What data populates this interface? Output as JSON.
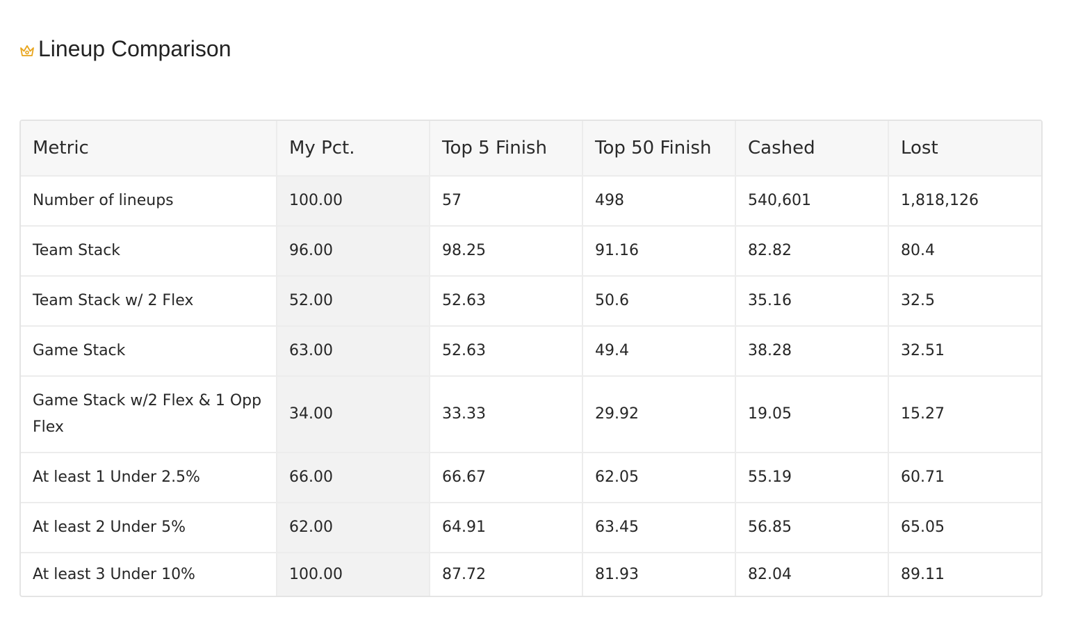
{
  "title": "Lineup Comparison",
  "icon": "crown-icon",
  "accent_color": "#e8a41a",
  "table": {
    "headers": [
      "Metric",
      "My Pct.",
      "Top 5 Finish",
      "Top 50 Finish",
      "Cashed",
      "Lost"
    ],
    "rows": [
      [
        "Number of lineups",
        "100.00",
        "57",
        "498",
        "540,601",
        "1,818,126"
      ],
      [
        "Team Stack",
        "96.00",
        "98.25",
        "91.16",
        "82.82",
        "80.4"
      ],
      [
        "Team Stack w/ 2 Flex",
        "52.00",
        "52.63",
        "50.6",
        "35.16",
        "32.5"
      ],
      [
        "Game Stack",
        "63.00",
        "52.63",
        "49.4",
        "38.28",
        "32.51"
      ],
      [
        "Game Stack w/2 Flex & 1 Opp Flex",
        "34.00",
        "33.33",
        "29.92",
        "19.05",
        "15.27"
      ],
      [
        "At least 1 Under 2.5%",
        "66.00",
        "66.67",
        "62.05",
        "55.19",
        "60.71"
      ],
      [
        "At least 2 Under 5%",
        "62.00",
        "64.91",
        "63.45",
        "56.85",
        "65.05"
      ],
      [
        "At least 3 Under 10%",
        "100.00",
        "87.72",
        "81.93",
        "82.04",
        "89.11"
      ]
    ]
  }
}
